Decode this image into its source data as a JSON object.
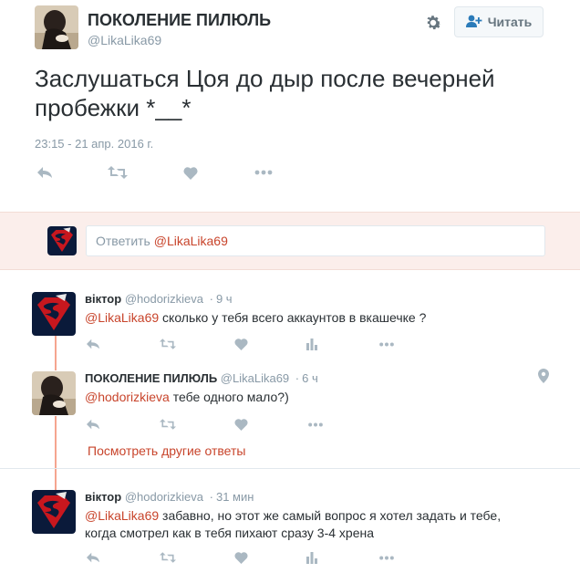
{
  "profile": {
    "name": "ПОКОЛЕНИЕ ПИЛЮЛЬ",
    "handle": "@LikaLika69",
    "follow_label": "Читать"
  },
  "tweet": {
    "text": "Заслушаться Цоя до дыр после вечерней пробежки *__*",
    "time": "23:15 - 21 апр. 2016 г."
  },
  "reply_box": {
    "placeholder": "Ответить ",
    "mention": "@LikaLika69"
  },
  "replies": [
    {
      "name": "віктор",
      "handle": "@hodorizkieva",
      "time": "9 ч",
      "mention": "@LikaLika69",
      "text": " сколько у тебя всего аккаунтов в вкашечке ?"
    },
    {
      "name": "ПОКОЛЕНИЕ ПИЛЮЛЬ",
      "handle": "@LikaLika69",
      "time": "6 ч",
      "mention": "@hodorizkieva",
      "text": " тебе одного мало?)"
    },
    {
      "name": "віктор",
      "handle": "@hodorizkieva",
      "time": "31 мин",
      "mention": "@LikaLika69",
      "text": " забавно, но этот же самый вопрос я хотел задать и тебе, когда смотрел как в тебя пихают сразу 3-4 хрена"
    }
  ],
  "more_replies_label": "Посмотреть другие ответы",
  "colors": {
    "accent": "#c8442b",
    "reply_box_bg": "#fbeeeb",
    "muted": "#8899a6",
    "thread_line": "#f5a58f"
  },
  "icons": [
    "gear-icon",
    "follow-user-icon",
    "reply-icon",
    "retweet-icon",
    "like-icon",
    "more-icon",
    "stats-icon",
    "location-pin-icon"
  ]
}
